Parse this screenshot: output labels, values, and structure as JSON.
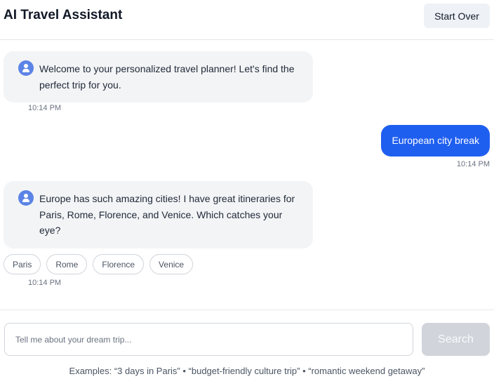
{
  "header": {
    "title": "AI Travel Assistant",
    "start_over_label": "Start Over"
  },
  "messages": [
    {
      "role": "assistant",
      "text": "Welcome to your personalized travel planner! Let's find the perfect trip for you.",
      "time": "10:14 PM"
    },
    {
      "role": "user",
      "text": "European city break",
      "time": "10:14 PM"
    },
    {
      "role": "assistant",
      "text": "Europe has such amazing cities! I have great itineraries for Paris, Rome, Florence, and Venice. Which catches your eye?",
      "time": "10:14 PM",
      "suggestions": [
        "Paris",
        "Rome",
        "Florence",
        "Venice"
      ]
    }
  ],
  "composer": {
    "placeholder": "Tell me about your dream trip...",
    "value": "",
    "search_label": "Search",
    "examples": "Examples: “3 days in Paris” • “budget-friendly culture trip” • “romantic weekend getaway”"
  },
  "colors": {
    "user_bubble": "#1f5ff0",
    "assistant_bubble": "#f3f4f6",
    "bot_icon": "#5b84e6",
    "search_disabled": "#d1d5db"
  },
  "icons": {
    "assistant_avatar": "user-circle-icon"
  }
}
